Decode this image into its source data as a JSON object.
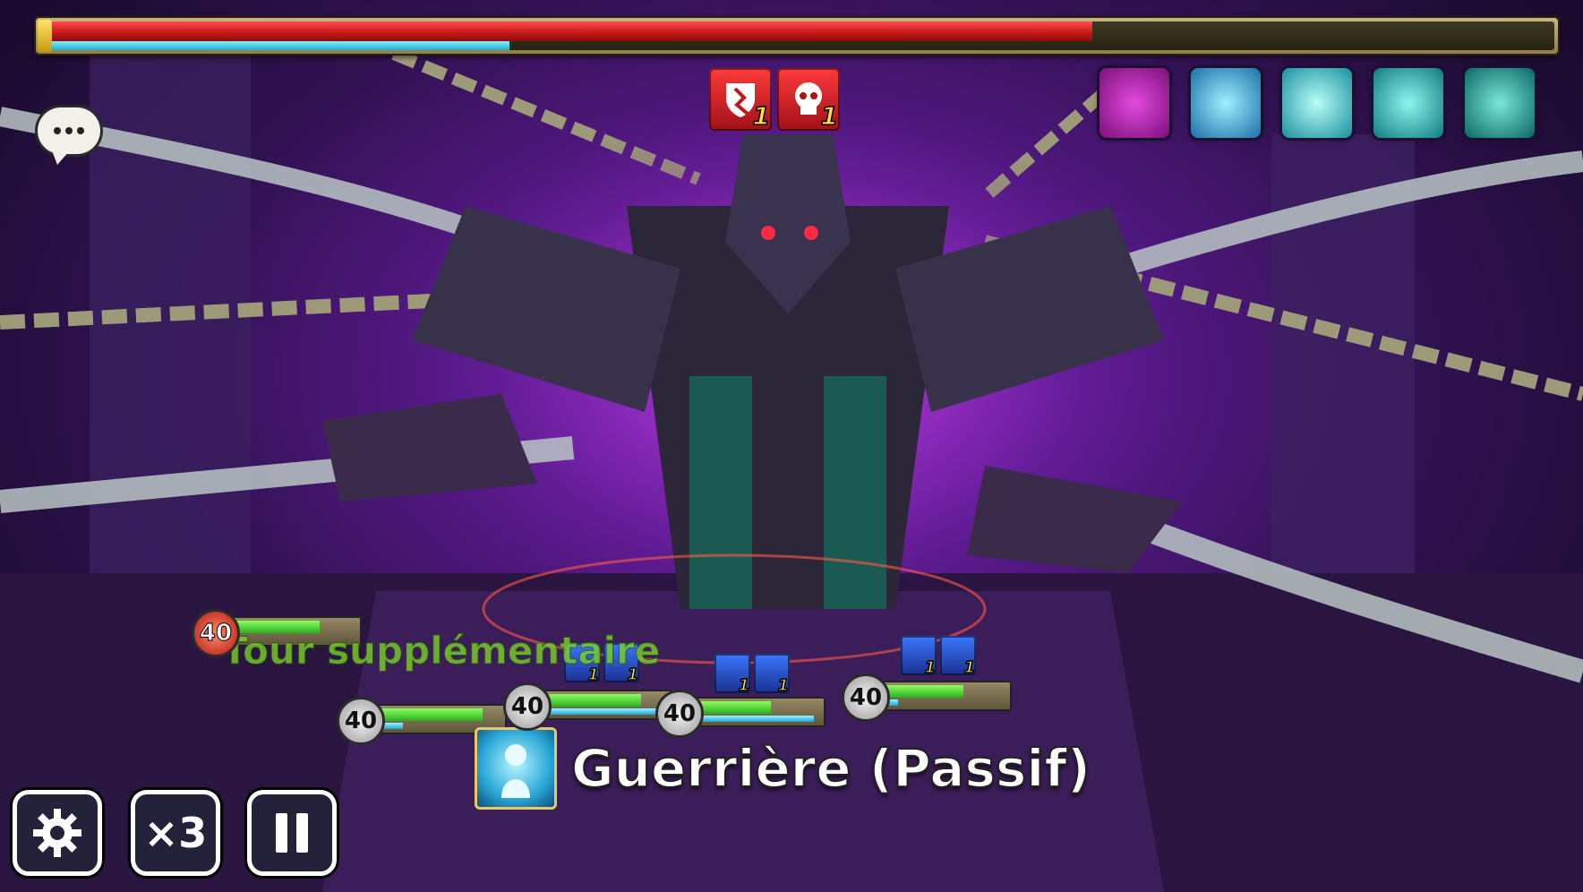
{
  "boss": {
    "hp_fraction": 0.695,
    "atb_fraction": 0.31
  },
  "boss_debuffs": [
    {
      "icon": "broken-shield-icon",
      "turns": "1"
    },
    {
      "icon": "skull-icon",
      "turns": "1"
    }
  ],
  "boss_passives": [
    {
      "icon": "purple-sigil-icon",
      "color": "#c21fb6"
    },
    {
      "icon": "spirit-figure-icon",
      "color": "#2aa6d8"
    },
    {
      "icon": "gate-icon",
      "color": "#2ac0cc"
    },
    {
      "icon": "skull-helm-icon",
      "color": "#1fb3b3"
    },
    {
      "icon": "demon-face-icon",
      "color": "#1a9e9a"
    }
  ],
  "units": [
    {
      "level": "40",
      "hp_fraction": 0.7,
      "atb_fraction": 0.05,
      "variant": "red"
    },
    {
      "level": "40",
      "hp_fraction": 0.85,
      "atb_fraction": 0.2,
      "variant": "normal"
    },
    {
      "level": "40",
      "hp_fraction": 0.78,
      "atb_fraction": 1.0,
      "variant": "normal"
    },
    {
      "level": "40",
      "hp_fraction": 0.6,
      "atb_fraction": 0.95,
      "variant": "normal"
    },
    {
      "level": "40",
      "hp_fraction": 0.65,
      "atb_fraction": 0.12,
      "variant": "normal"
    }
  ],
  "unit_buffs": {
    "group1": [
      {
        "turns": "1"
      },
      {
        "turns": "1"
      }
    ],
    "group2": [
      {
        "turns": "1"
      },
      {
        "turns": "1"
      }
    ],
    "group3": [
      {
        "turns": "1"
      },
      {
        "turns": "1"
      }
    ]
  },
  "effect_text": "Tour supplémentaire",
  "skill": {
    "name": "Guerrière (Passif)",
    "icon": "warrior-spirit-icon"
  },
  "controls": {
    "speed_label": "×3",
    "settings_icon": "gear-icon",
    "pause_icon": "pause-icon"
  }
}
